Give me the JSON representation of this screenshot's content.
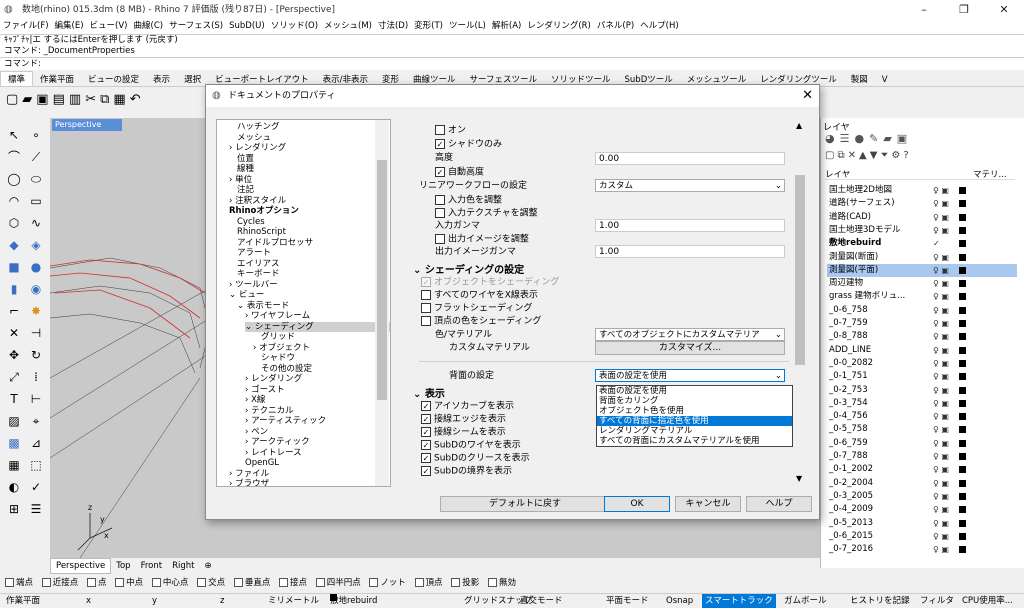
{
  "window": {
    "title": "数地(rhino) 015.3dm (8 MB) - Rhino 7 評価版 (残り87日) - [Perspective]"
  },
  "menu": [
    "ファイル(F)",
    "編集(E)",
    "ビュー(V)",
    "曲線(C)",
    "サーフェス(S)",
    "SubD(U)",
    "ソリッド(O)",
    "メッシュ(M)",
    "寸法(D)",
    "変形(T)",
    "ツール(L)",
    "解析(A)",
    "レンダリング(R)",
    "パネル(P)",
    "ヘルプ(H)"
  ],
  "command": {
    "line1": "ｷｬﾌﾟﾁｬ|エ  するにはEnterを押します (元戻す)",
    "line2": "コマンド: _DocumentProperties",
    "prompt": "コマンド:"
  },
  "tabs": [
    "標準",
    "作業平面",
    "ビューの設定",
    "表示",
    "選択",
    "ビューポートレイアウト",
    "表示/非表示",
    "変形",
    "曲線ツール",
    "サーフェスツール",
    "ソリッドツール",
    "SubDツール",
    "メッシュツール",
    "レンダリングツール",
    "製図",
    "V"
  ],
  "viewport": {
    "label": "Perspective",
    "tabs": [
      "Perspective",
      "Top",
      "Front",
      "Right"
    ],
    "axis_x": "x",
    "axis_y": "y",
    "axis_z": "z"
  },
  "dialog": {
    "title": "ドキュメントのプロパティ",
    "tree": [
      {
        "t": "ハッチング",
        "l": 1
      },
      {
        "t": "メッシュ",
        "l": 1
      },
      {
        "t": "レンダリング",
        "l": 1,
        "e": ">"
      },
      {
        "t": "位置",
        "l": 1
      },
      {
        "t": "線種",
        "l": 1
      },
      {
        "t": "単位",
        "l": 1,
        "e": ">"
      },
      {
        "t": "注記",
        "l": 1
      },
      {
        "t": "注釈スタイル",
        "l": 1,
        "e": ">"
      },
      {
        "t": "Rhinoオプション",
        "l": 0,
        "b": true
      },
      {
        "t": "Cycles",
        "l": 1
      },
      {
        "t": "RhinoScript",
        "l": 1
      },
      {
        "t": "アイドルプロセッサ",
        "l": 1
      },
      {
        "t": "アラート",
        "l": 1
      },
      {
        "t": "エイリアス",
        "l": 1
      },
      {
        "t": "キーボード",
        "l": 1
      },
      {
        "t": "ツールバー",
        "l": 1,
        "e": ">"
      },
      {
        "t": "ビュー",
        "l": 1,
        "e": "v"
      },
      {
        "t": "表示モード",
        "l": 2,
        "e": "v"
      },
      {
        "t": "ワイヤフレーム",
        "l": 3,
        "e": ">"
      },
      {
        "t": "シェーディング",
        "l": 3,
        "e": "v",
        "s": true
      },
      {
        "t": "グリッド",
        "l": 4
      },
      {
        "t": "オブジェクト",
        "l": 4,
        "e": ">"
      },
      {
        "t": "シャドウ",
        "l": 4
      },
      {
        "t": "その他の設定",
        "l": 4
      },
      {
        "t": "レンダリング",
        "l": 3,
        "e": ">"
      },
      {
        "t": "ゴースト",
        "l": 3,
        "e": ">"
      },
      {
        "t": "X線",
        "l": 3,
        "e": ">"
      },
      {
        "t": "テクニカル",
        "l": 3,
        "e": ">"
      },
      {
        "t": "アーティスティック",
        "l": 3,
        "e": ">"
      },
      {
        "t": "ペン",
        "l": 3,
        "e": ">"
      },
      {
        "t": "アークティック",
        "l": 3,
        "e": ">"
      },
      {
        "t": "レイトレース",
        "l": 3,
        "e": ">"
      },
      {
        "t": "OpenGL",
        "l": 2
      },
      {
        "t": "ファイル",
        "l": 1,
        "e": ">"
      },
      {
        "t": "ブラウザ",
        "l": 1,
        "e": ">"
      }
    ],
    "settings": {
      "on": "オン",
      "shadow_only": "シャドウのみ",
      "height_label": "高度",
      "height_value": "0.00",
      "auto_height": "自動高度",
      "linear_workflow": "リニアワークフローの設定",
      "linear_value": "カスタム",
      "adjust_input_color": "入力色を調整",
      "adjust_input_texture": "入力テクスチャを調整",
      "input_gamma": "入力ガンマ",
      "input_gamma_value": "1.00",
      "adjust_output_image": "出力イメージを調整",
      "output_gamma": "出力イメージガンマ",
      "output_gamma_value": "1.00",
      "shading_section": "シェーディングの設定",
      "shade_objects": "オブジェクトをシェーディング",
      "all_wires_xray": "すべてのワイヤをX線表示",
      "flat_shading": "フラットシェーディング",
      "vertex_color_shading": "頂点の色をシェーディング",
      "color_material": "色/マテリアル",
      "color_material_value": "すべてのオブジェクトにカスタムマテリア",
      "custom_material": "カスタムマテリアル",
      "customize_btn": "カスタマイズ...",
      "backface": "背面の設定",
      "backface_value": "表面の設定を使用",
      "display_section": "表示",
      "iso_curves": "アイソカーブを表示",
      "tangent_edges": "接線エッジを表示",
      "tangent_seams": "接線シームを表示",
      "subd_wires": "SubDのワイヤを表示",
      "subd_creases": "SubDのクリースを表示",
      "subd_borders": "SubDの境界を表示"
    },
    "dropdown": [
      "表面の設定を使用",
      "背面をカリング",
      "オブジェクト色を使用",
      "すべての背面に指定色を使用",
      "レンダリングマテリアル",
      "すべての背面にカスタムマテリアルを使用"
    ],
    "buttons": {
      "defaults": "デフォルトに戻す",
      "ok": "OK",
      "cancel": "キャンセル",
      "help": "ヘルプ"
    }
  },
  "layers": {
    "tab": "レイヤ",
    "header_name": "レイヤ",
    "header_material": "マテリ...",
    "items": [
      "国土地理2D地図",
      "道路(サーフェス)",
      "道路(CAD)",
      "国土地理3Dモデル",
      "敷地rebuird",
      "測量図(断面)",
      "測量図(平面)",
      "周辺建物",
      "grass 建物ボリュ...",
      "_0-6_758",
      "_0-7_759",
      "_0-8_788",
      "ADD_LINE",
      "_0-0_2082",
      "_0-1_751",
      "_0-2_753",
      "_0-3_754",
      "_0-4_756",
      "_0-5_758",
      "_0-6_759",
      "_0-7_788",
      "_0-1_2002",
      "_0-2_2004",
      "_0-3_2005",
      "_0-4_2009",
      "_0-5_2013",
      "_0-6_2015",
      "_0-7_2016"
    ]
  },
  "osnap": [
    "端点",
    "近接点",
    "点",
    "中点",
    "中心点",
    "交点",
    "垂直点",
    "接点",
    "四半円点",
    "ノット",
    "頂点",
    "投影",
    "無効"
  ],
  "status": {
    "cplane": "作業平面",
    "x": "x",
    "y": "y",
    "z": "z",
    "units": "ミリメートル",
    "layer": "敷地rebuird",
    "grid_snap": "グリッドスナップ",
    "ortho": "直交モード",
    "planar": "平面モード",
    "osnap": "Osnap",
    "smarttrack": "スマートトラック",
    "gumball": "ガムボール",
    "history": "ヒストリを記録",
    "filter": "フィルタ",
    "cpu": "CPU使用率..."
  }
}
